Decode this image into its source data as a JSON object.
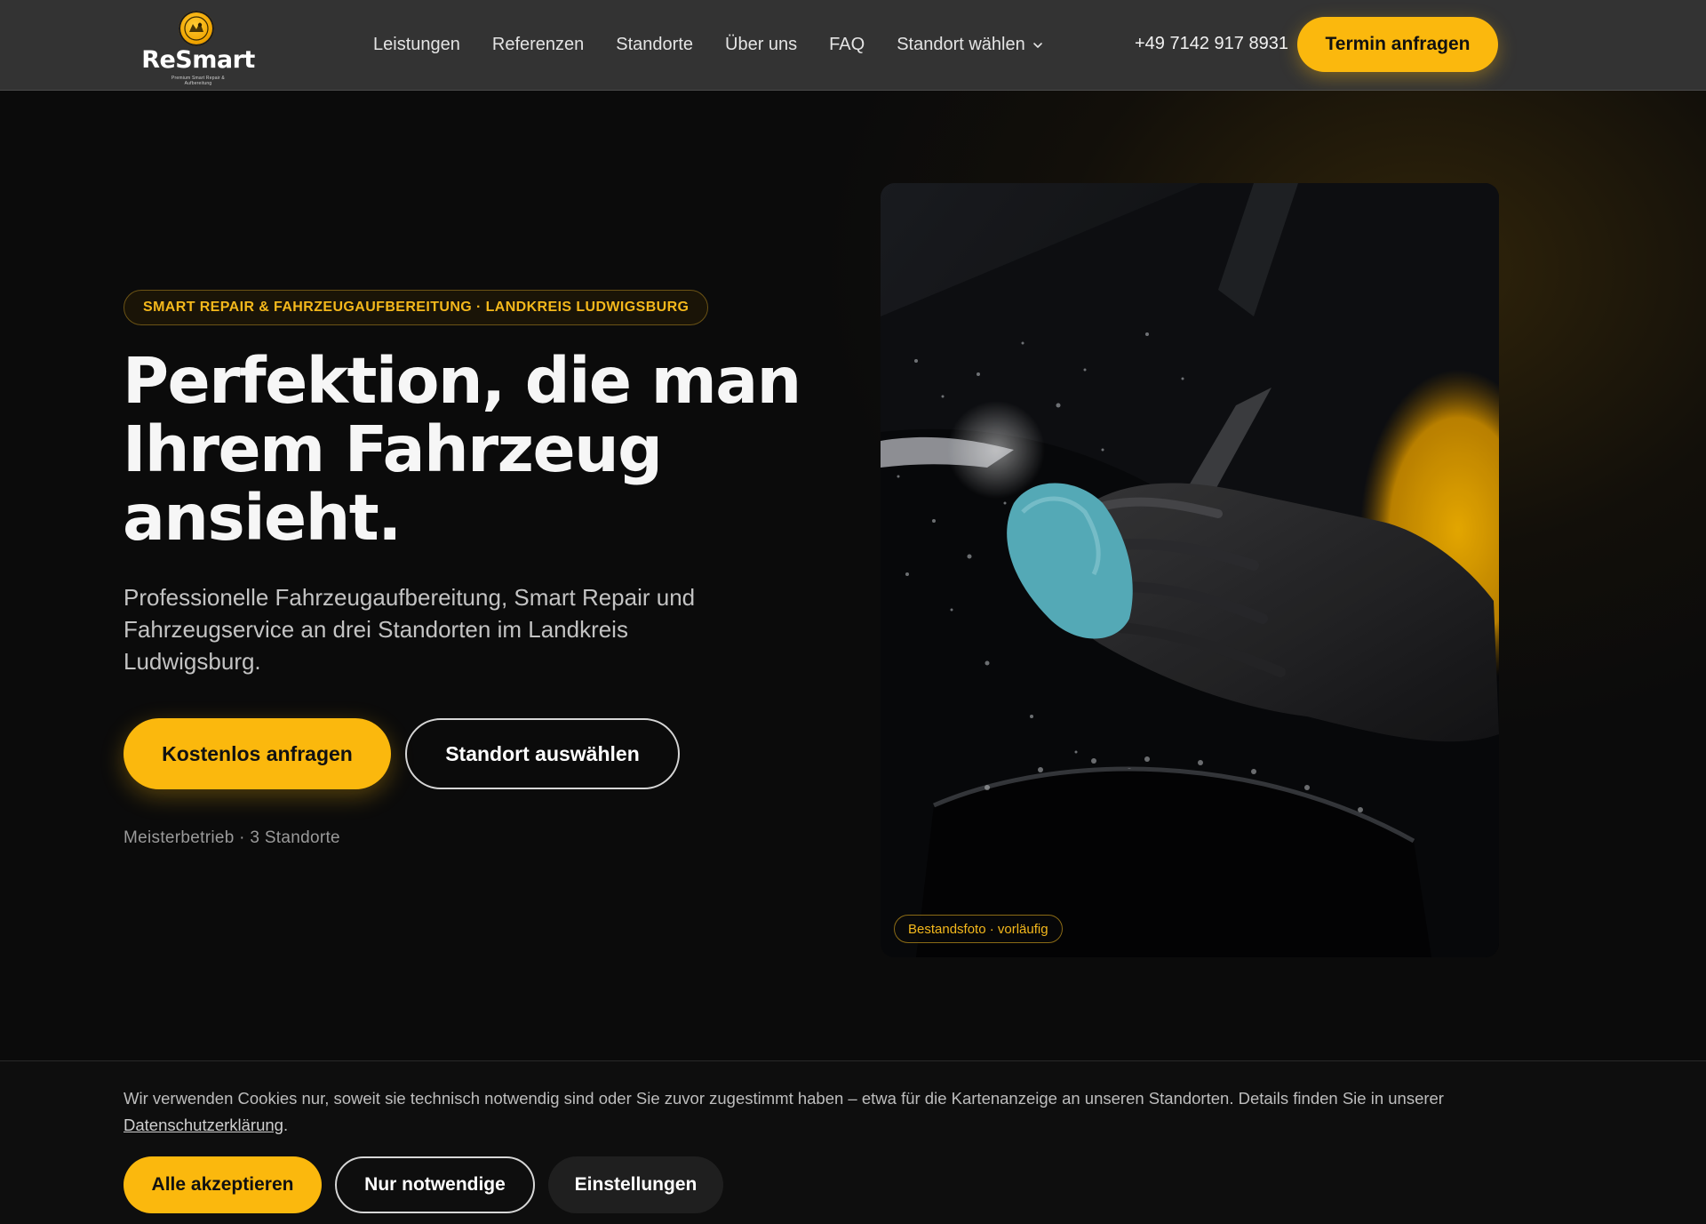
{
  "brand": {
    "name": "ReSmart",
    "tagline": "Premium Smart Repair & Aufbereitung",
    "accent_color": "#fbb80d"
  },
  "nav": {
    "links": [
      "Leistungen",
      "Referenzen",
      "Standorte",
      "Über uns",
      "FAQ"
    ],
    "location_select": "Standort wählen",
    "phone": "+49 7142 917 8931",
    "cta": "Termin anfragen"
  },
  "hero": {
    "eyebrow": "SMART REPAIR & FAHRZEUGAUFBEREITUNG · LANDKREIS LUDWIGSBURG",
    "headline": "Perfektion, die man Ihrem Fahrzeug ansieht.",
    "subtext": "Professionelle Fahrzeugaufbereitung, Smart Repair und Fahrzeugservice an drei Standorten im Landkreis Ludwigsburg.",
    "primary_button": "Kostenlos anfragen",
    "secondary_button": "Standort auswählen",
    "meta": "Meisterbetrieb · 3 Standorte",
    "photo_caption": "Bestandsfoto · vorläufig"
  },
  "cookie": {
    "text": "Wir verwenden Cookies nur, soweit sie technisch notwendig sind oder Sie zuvor zugestimmt haben – etwa für die Kartenanzeige an unseren Standorten. Details finden Sie in unserer ",
    "link": "Datenschutzerklärung",
    "text_end": ".",
    "accept": "Alle akzeptieren",
    "necessary": "Nur notwendige",
    "settings": "Einstellungen"
  }
}
